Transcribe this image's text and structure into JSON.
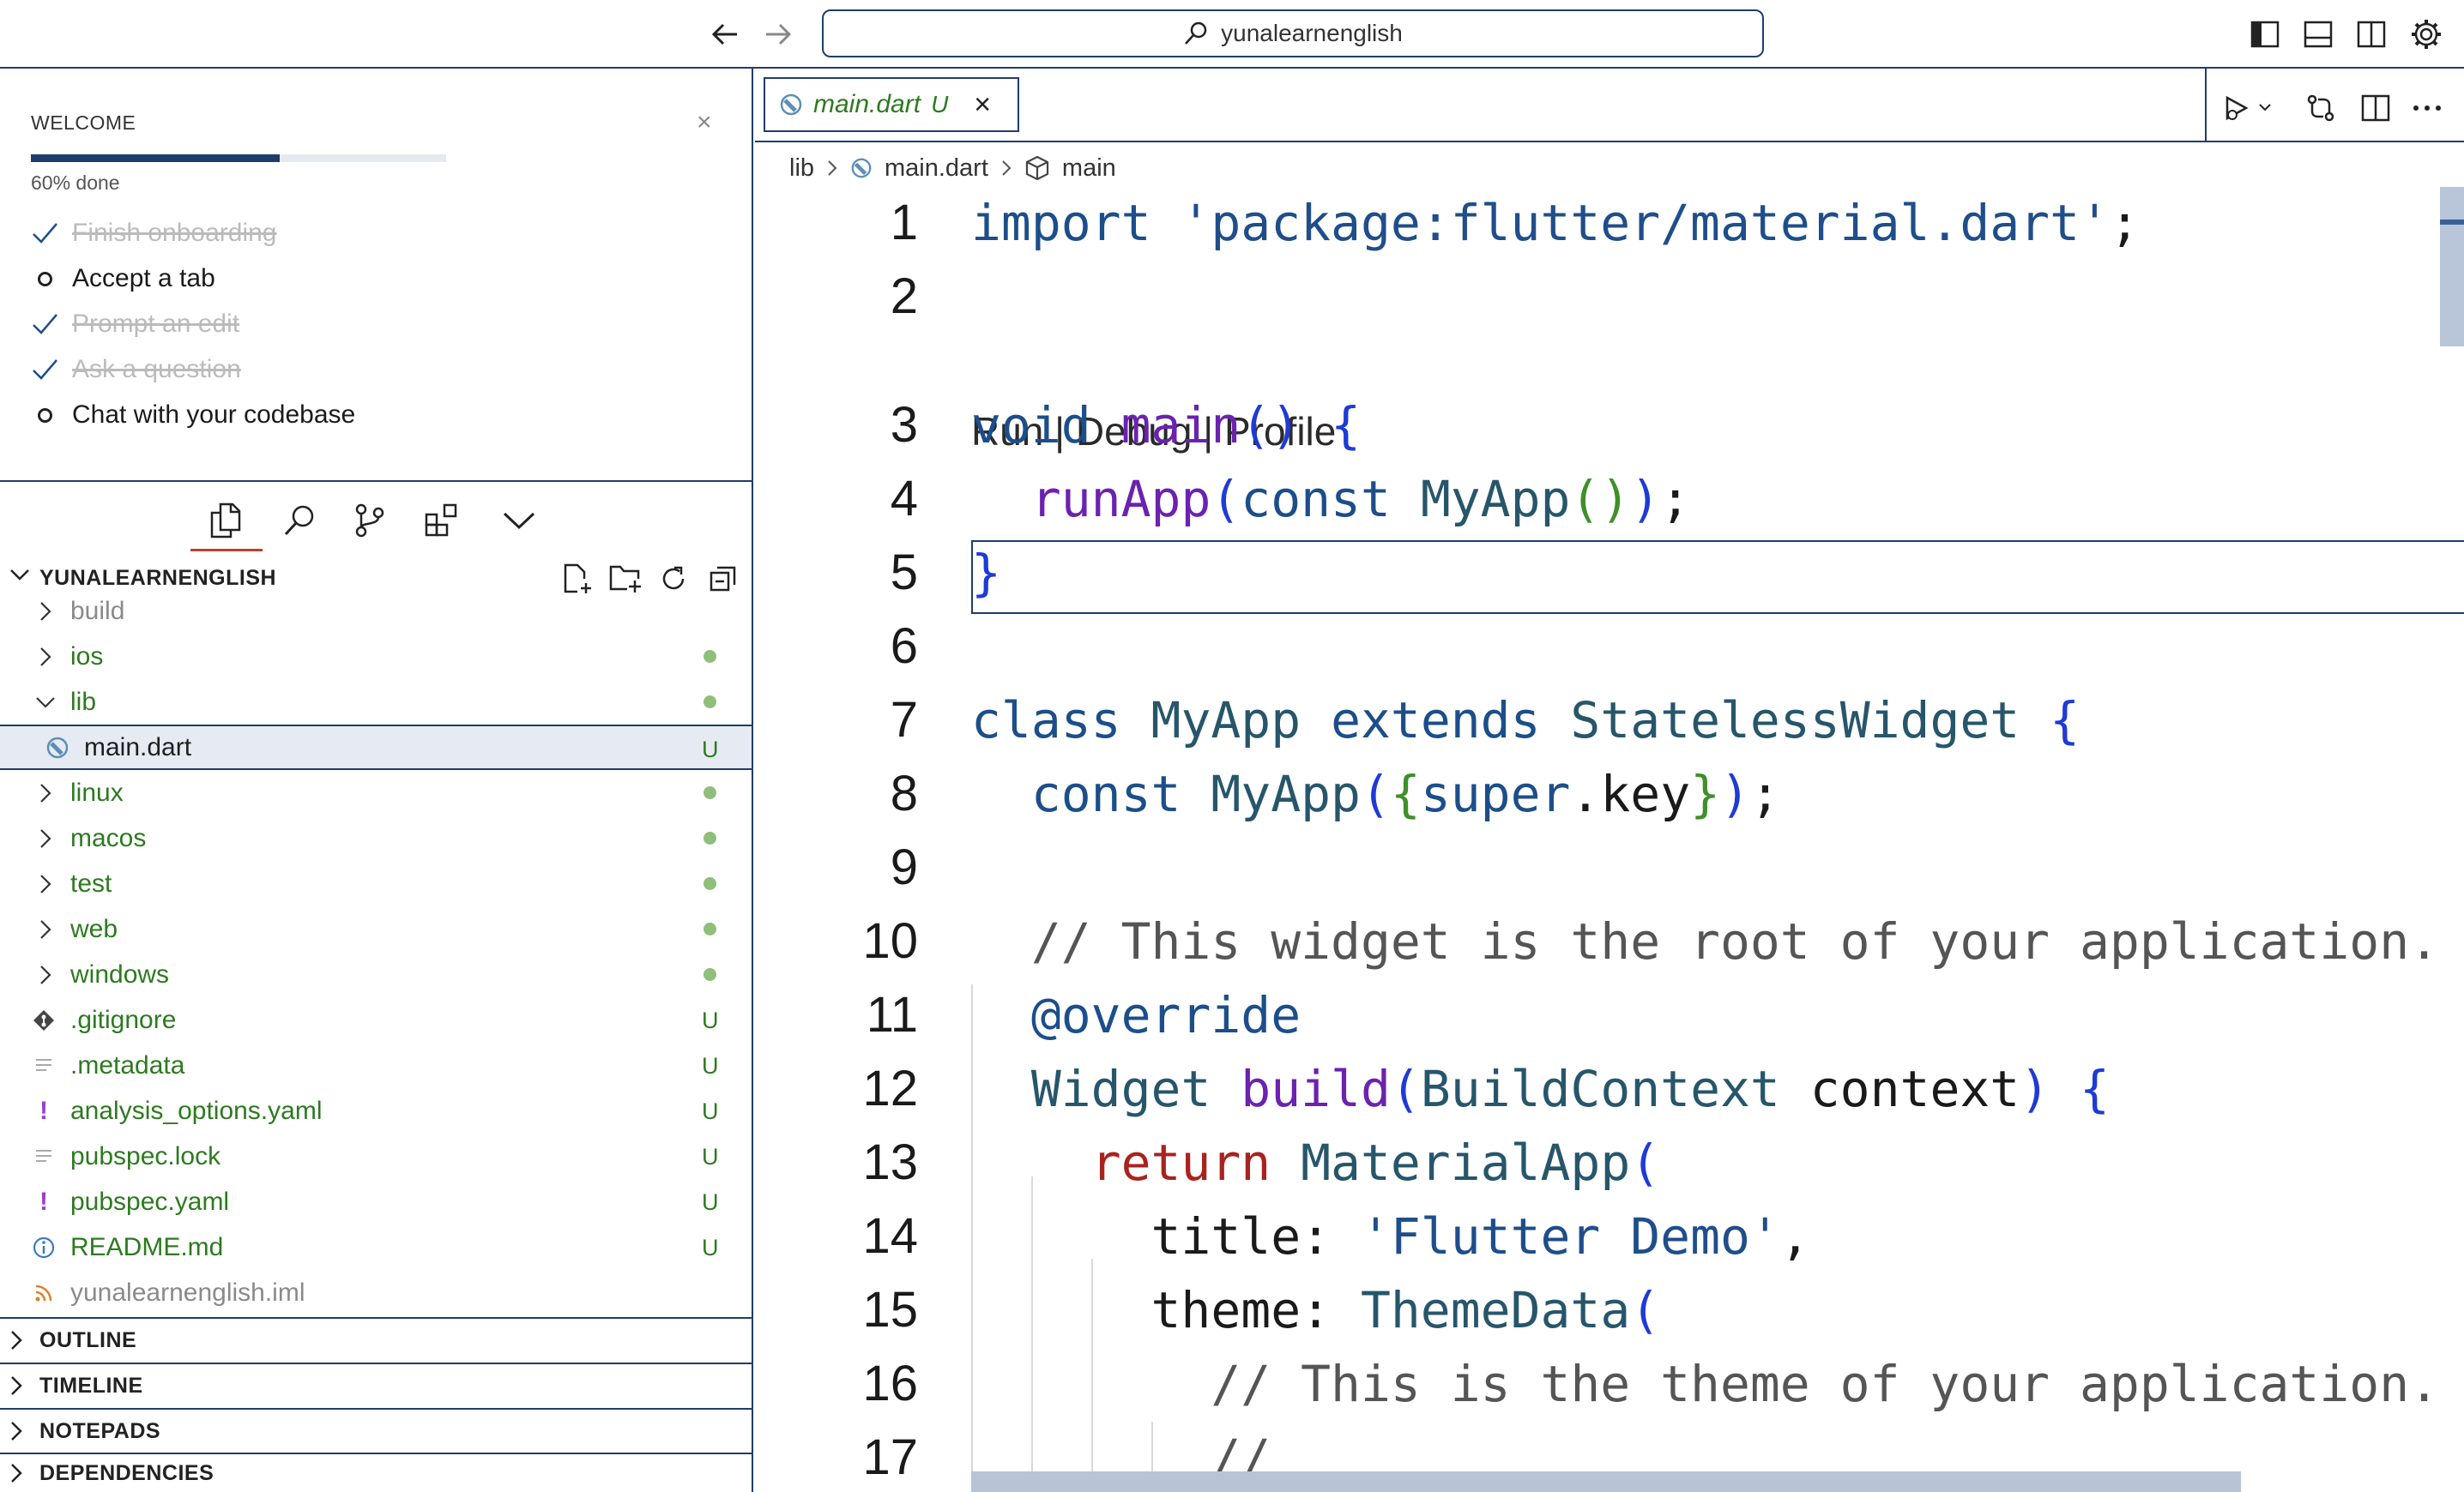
{
  "titlebar": {
    "search_text": "yunalearnenglish"
  },
  "welcome": {
    "title": "WELCOME",
    "close_glyph": "×",
    "progress_fraction": 0.6,
    "progress_text": "60% done",
    "tasks": [
      {
        "label": "Finish onboarding",
        "done": true
      },
      {
        "label": "Accept a tab",
        "done": false
      },
      {
        "label": "Prompt an edit",
        "done": true
      },
      {
        "label": "Ask a question",
        "done": true
      },
      {
        "label": "Chat with your codebase",
        "done": false
      }
    ]
  },
  "explorer": {
    "title": "YUNALEARNENGLISH",
    "items": [
      {
        "label": "build",
        "kind": "folder",
        "expanded": false,
        "status": "",
        "grey": true
      },
      {
        "label": "ios",
        "kind": "folder",
        "expanded": false,
        "status": "dot"
      },
      {
        "label": "lib",
        "kind": "folder",
        "expanded": true,
        "status": "dot"
      },
      {
        "label": "main.dart",
        "kind": "dart",
        "status": "U",
        "selected": true
      },
      {
        "label": "linux",
        "kind": "folder",
        "expanded": false,
        "status": "dot"
      },
      {
        "label": "macos",
        "kind": "folder",
        "expanded": false,
        "status": "dot"
      },
      {
        "label": "test",
        "kind": "folder",
        "expanded": false,
        "status": "dot"
      },
      {
        "label": "web",
        "kind": "folder",
        "expanded": false,
        "status": "dot"
      },
      {
        "label": "windows",
        "kind": "folder",
        "expanded": false,
        "status": "dot"
      },
      {
        "label": ".gitignore",
        "kind": "git",
        "status": "U"
      },
      {
        "label": ".metadata",
        "kind": "lines",
        "status": "U"
      },
      {
        "label": "analysis_options.yaml",
        "kind": "yaml",
        "status": "U"
      },
      {
        "label": "pubspec.lock",
        "kind": "lines",
        "status": "U"
      },
      {
        "label": "pubspec.yaml",
        "kind": "yaml",
        "status": "U"
      },
      {
        "label": "README.md",
        "kind": "info",
        "status": "U"
      },
      {
        "label": "yunalearnenglish.iml",
        "kind": "rss",
        "status": "",
        "grey": true
      }
    ]
  },
  "panels": [
    "OUTLINE",
    "TIMELINE",
    "NOTEPADS",
    "DEPENDENCIES"
  ],
  "editor": {
    "tab": {
      "label": "main.dart",
      "badge": "U",
      "close_glyph": "×"
    },
    "breadcrumb": [
      "lib",
      "main.dart",
      "main"
    ],
    "codelens": "Run | Debug | Profile",
    "line_numbers": [
      "1",
      "2",
      "3",
      "4",
      "5",
      "6",
      "7",
      "8",
      "9",
      "10",
      "11",
      "12",
      "13",
      "14",
      "15",
      "16",
      "17"
    ],
    "lines": [
      "import 'package:flutter/material.dart';",
      "",
      "void main() {",
      "  runApp(const MyApp());",
      "}",
      "",
      "class MyApp extends StatelessWidget {",
      "  const MyApp({super.key});",
      "",
      "  // This widget is the root of your application.",
      "  @override",
      "  Widget build(BuildContext context) {",
      "    return MaterialApp(",
      "      title: 'Flutter Demo',",
      "      theme: ThemeData(",
      "        // This is the theme of your application.",
      "        //"
    ]
  },
  "icons": {
    "nav_back": "arrow-left-icon",
    "nav_forward": "arrow-right-icon",
    "search": "search-icon",
    "layout": [
      "toggle-sidebar-icon",
      "toggle-panel-icon",
      "toggle-secondary-sidebar-icon",
      "settings-gear-icon"
    ],
    "activity": [
      "files-icon",
      "search-icon",
      "source-control-icon",
      "extensions-icon",
      "chevron-down-icon"
    ],
    "explorer_actions": [
      "new-file-icon",
      "new-folder-icon",
      "refresh-icon",
      "collapse-all-icon"
    ],
    "editor_actions": [
      "run-debug-icon",
      "compare-changes-icon",
      "split-editor-icon",
      "more-actions-icon"
    ]
  },
  "colors": {
    "accent": "#1f3d6b",
    "git_added": "#2d7a20",
    "git_dot": "#8fbf7a"
  }
}
